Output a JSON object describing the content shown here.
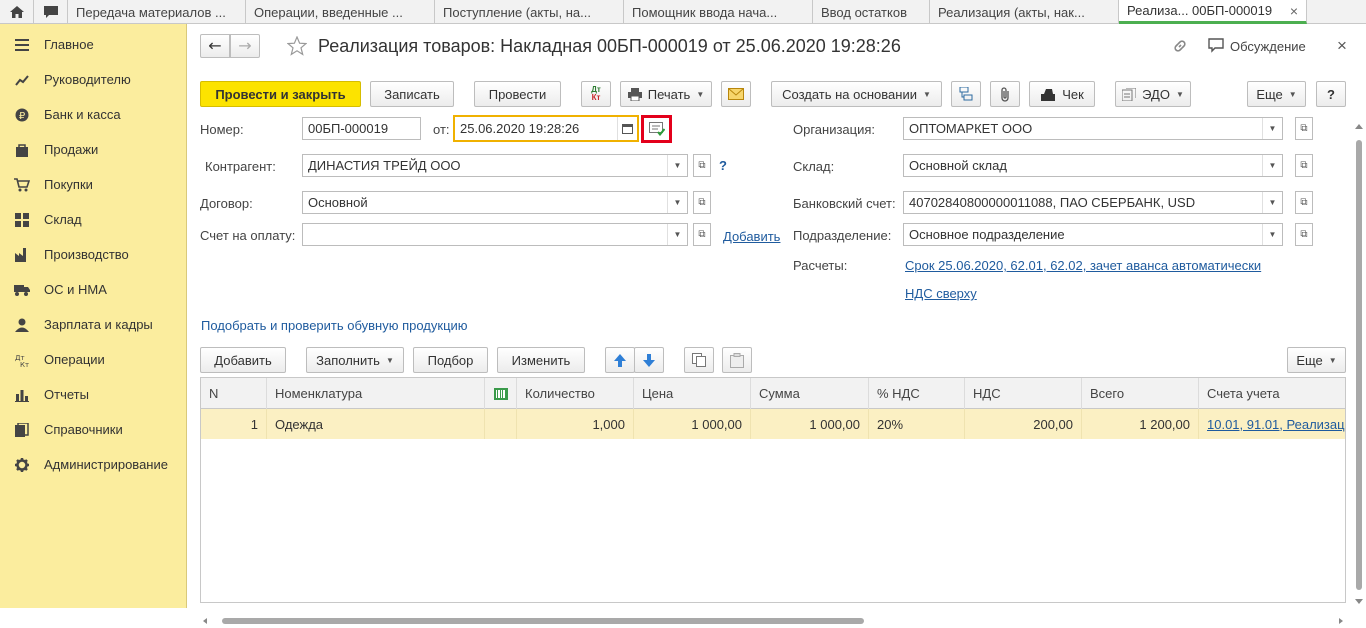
{
  "tabs": [
    {
      "label": "Передача материалов ..."
    },
    {
      "label": "Операции, введенные ..."
    },
    {
      "label": "Поступление (акты, на..."
    },
    {
      "label": "Помощник ввода нача..."
    },
    {
      "label": "Ввод остатков"
    },
    {
      "label": "Реализация (акты, нак..."
    },
    {
      "label": "Реализа...   00БП-000019",
      "close": "×"
    }
  ],
  "sidebar": {
    "items": [
      {
        "label": "Главное",
        "icon": "menu-icon"
      },
      {
        "label": "Руководителю",
        "icon": "chart-line-icon"
      },
      {
        "label": "Банк и касса",
        "icon": "ruble-icon"
      },
      {
        "label": "Продажи",
        "icon": "bag-icon"
      },
      {
        "label": "Покупки",
        "icon": "cart-icon"
      },
      {
        "label": "Склад",
        "icon": "warehouse-icon"
      },
      {
        "label": "Производство",
        "icon": "factory-icon"
      },
      {
        "label": "ОС и НМА",
        "icon": "truck-icon"
      },
      {
        "label": "Зарплата и кадры",
        "icon": "person-icon"
      },
      {
        "label": "Операции",
        "icon": "dt-kt-icon"
      },
      {
        "label": "Отчеты",
        "icon": "bar-chart-icon"
      },
      {
        "label": "Справочники",
        "icon": "book-icon"
      },
      {
        "label": "Администрирование",
        "icon": "gear-icon"
      }
    ]
  },
  "header": {
    "title": "Реализация товаров: Накладная 00БП-000019 от 25.06.2020 19:28:26",
    "discussion": "Обсуждение",
    "close": "×"
  },
  "toolbar": {
    "post_close": "Провести и закрыть",
    "save": "Записать",
    "post": "Провести",
    "dtkt": "Дт Кт",
    "print": "Печать",
    "create_based": "Создать на основании",
    "check": "Чек",
    "edo": "ЭДО",
    "more": "Еще",
    "help": "?"
  },
  "form": {
    "number_label": "Номер:",
    "number_value": "00БП-000019",
    "date_label": "от:",
    "date_value": "25.06.2020 19:28:26",
    "org_label": "Организация:",
    "org_value": "ОПТОМАРКЕТ ООО",
    "contractor_label": "Контрагент:",
    "contractor_value": "ДИНАСТИЯ ТРЕЙД ООО",
    "contractor_help": "?",
    "warehouse_label": "Склад:",
    "warehouse_value": "Основной склад",
    "contract_label": "Договор:",
    "contract_value": "Основной",
    "bank_label": "Банковский счет:",
    "bank_value": "40702840800000011088, ПАО СБЕРБАНК, USD",
    "invoice_label": "Счет на оплату:",
    "invoice_value": "",
    "add_link": "Добавить",
    "division_label": "Подразделение:",
    "division_value": "Основное подразделение",
    "settlements_label": "Расчеты:",
    "settlements_link": "Срок 25.06.2020, 62.01, 62.02, зачет аванса автоматически",
    "vat_link": "НДС сверху",
    "shoes_link": "Подобрать и проверить обувную продукцию"
  },
  "table_toolbar": {
    "add": "Добавить",
    "fill": "Заполнить",
    "select": "Подбор",
    "change": "Изменить",
    "more": "Еще"
  },
  "table": {
    "columns": [
      "N",
      "Номенклатура",
      "",
      "Количество",
      "Цена",
      "Сумма",
      "% НДС",
      "НДС",
      "Всего",
      "Счета учета"
    ],
    "rows": [
      {
        "n": "1",
        "item": "Одежда",
        "qty": "1,000",
        "price": "1 000,00",
        "sum": "1 000,00",
        "vat_rate": "20%",
        "vat": "200,00",
        "total": "1 200,00",
        "accounts": "10.01, 91.01, Реализац"
      }
    ]
  },
  "colors": {
    "sidebar_bg": "#fbed9e",
    "primary_button": "#fce300",
    "row_highlight": "#fbf0c3",
    "link": "#1f5b9e",
    "highlight_box": "#e3001b"
  }
}
